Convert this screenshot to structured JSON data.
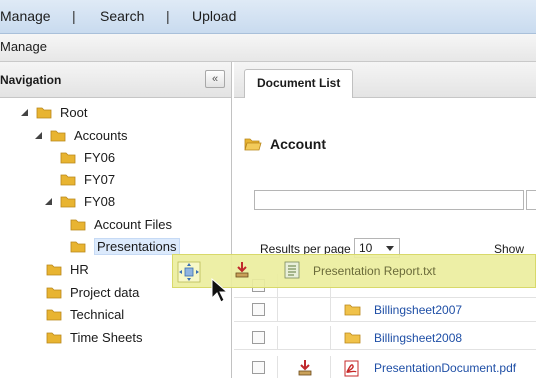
{
  "topnav": {
    "items": [
      "Manage",
      "Search",
      "Upload"
    ],
    "separator": "|"
  },
  "subbar": {
    "title": "Manage"
  },
  "navigation": {
    "title": "Navigation",
    "collapse_glyph": "«",
    "tree": [
      {
        "label": "Root",
        "expanded": true
      },
      {
        "label": "Accounts",
        "expanded": true
      },
      {
        "label": "FY06"
      },
      {
        "label": "FY07"
      },
      {
        "label": "FY08",
        "expanded": true
      },
      {
        "label": "Account Files"
      },
      {
        "label": "Presentations",
        "selected": true
      },
      {
        "label": "HR"
      },
      {
        "label": "Project data"
      },
      {
        "label": "Technical"
      },
      {
        "label": "Time Sheets"
      }
    ]
  },
  "document_list": {
    "tab_label": "Document List",
    "folder_title": "Account",
    "filter_value": "",
    "results_per_page_label": "Results per page",
    "results_per_page_value": "10",
    "show_label": "Show",
    "rows": [
      {
        "name": "Billingsheet2007",
        "type": "folder"
      },
      {
        "name": "Billingsheet2008",
        "type": "folder"
      },
      {
        "name": "PresentationDocument.pdf",
        "type": "pdf"
      }
    ]
  },
  "drag_proxy": {
    "file_label": "Presentation Report.txt"
  },
  "colors": {
    "folder": "#e8b431",
    "link": "#1f4fa6",
    "drag_bg": "#eceea0"
  },
  "icons": {
    "move": "move-arrows-icon",
    "download": "download-icon",
    "text_file": "text-file-icon",
    "pdf": "pdf-icon",
    "folder": "folder-icon",
    "cursor": "mouse-pointer-icon"
  }
}
